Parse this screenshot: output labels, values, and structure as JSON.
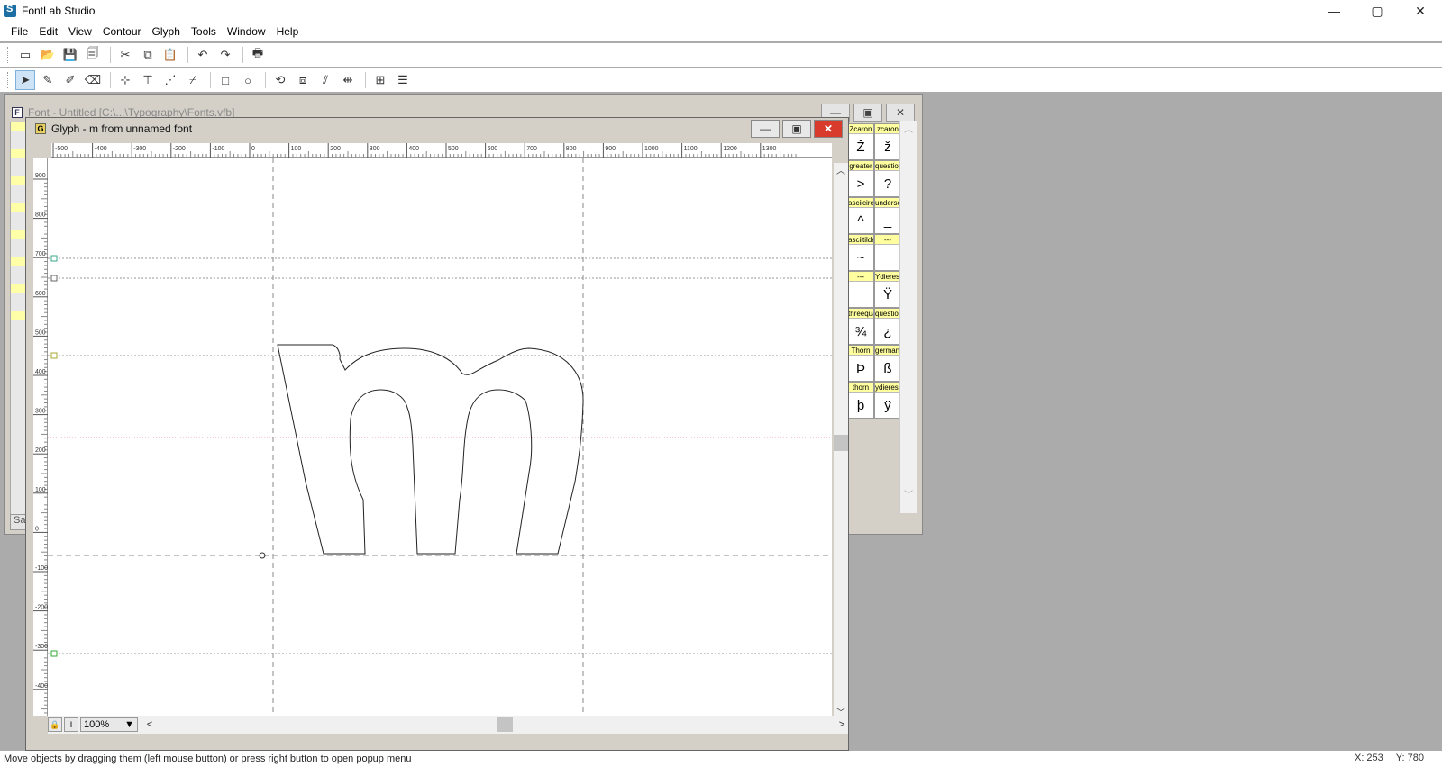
{
  "app": {
    "title": "FontLab Studio",
    "window_controls": {
      "minimize": "—",
      "maximize": "▢",
      "close": "✕"
    }
  },
  "menu": [
    "File",
    "Edit",
    "View",
    "Contour",
    "Glyph",
    "Tools",
    "Window",
    "Help"
  ],
  "toolbar1": [
    {
      "name": "new-icon",
      "glyph": "▭"
    },
    {
      "name": "open-icon",
      "glyph": "📂"
    },
    {
      "name": "save-icon",
      "glyph": "💾"
    },
    {
      "name": "save-all-icon",
      "glyph": "🗐"
    },
    {
      "name": "cut-icon",
      "glyph": "✂"
    },
    {
      "name": "copy-icon",
      "glyph": "⧉"
    },
    {
      "name": "paste-icon",
      "glyph": "📋"
    },
    {
      "name": "undo-icon",
      "glyph": "↶"
    },
    {
      "name": "redo-icon",
      "glyph": "↷"
    },
    {
      "name": "print-icon",
      "glyph": "🖶"
    }
  ],
  "toolbar2": [
    {
      "name": "pointer-tool-icon",
      "glyph": "➤",
      "active": true
    },
    {
      "name": "pen-tool-icon",
      "glyph": "✎"
    },
    {
      "name": "brush-tool-icon",
      "glyph": "✐"
    },
    {
      "name": "eraser-tool-icon",
      "glyph": "⌫"
    },
    {
      "name": "add-node-icon",
      "glyph": "⊹"
    },
    {
      "name": "add-corner-icon",
      "glyph": "⊤"
    },
    {
      "name": "add-curve-icon",
      "glyph": "⋰"
    },
    {
      "name": "add-tangent-icon",
      "glyph": "⌿"
    },
    {
      "name": "rectangle-tool-icon",
      "glyph": "□"
    },
    {
      "name": "ellipse-tool-icon",
      "glyph": "○"
    },
    {
      "name": "rotate-tool-icon",
      "glyph": "⟲"
    },
    {
      "name": "scale-tool-icon",
      "glyph": "⧈"
    },
    {
      "name": "slant-tool-icon",
      "glyph": "⫽"
    },
    {
      "name": "measure-tool-icon",
      "glyph": "⇹"
    },
    {
      "name": "grid-icon",
      "glyph": "⊞"
    },
    {
      "name": "align-icon",
      "glyph": "☰"
    }
  ],
  "font_window": {
    "title": "Font - Untitled [C:\\...\\Typography\\Fonts.vfb]",
    "status_left": "Sa",
    "glyph_cells": [
      [
        {
          "name": "Zcaron",
          "char": "Ž"
        },
        {
          "name": "zcaron",
          "char": "ž"
        }
      ],
      [
        {
          "name": "greater",
          "char": ">"
        },
        {
          "name": "question",
          "char": "?"
        }
      ],
      [
        {
          "name": "asciicircum",
          "char": "^"
        },
        {
          "name": "underscore",
          "char": "_"
        }
      ],
      [
        {
          "name": "asciitilde",
          "char": "~"
        },
        {
          "name": "---",
          "char": ""
        }
      ],
      [
        {
          "name": "---",
          "char": ""
        },
        {
          "name": "Ydieresis",
          "char": "Ÿ"
        }
      ],
      [
        {
          "name": "threequarters",
          "char": "¾"
        },
        {
          "name": "questiondown",
          "char": "¿"
        }
      ],
      [
        {
          "name": "Thorn",
          "char": "Þ"
        },
        {
          "name": "germandbls",
          "char": "ß"
        }
      ],
      [
        {
          "name": "thorn",
          "char": "þ"
        },
        {
          "name": "ydieresis",
          "char": "ÿ"
        }
      ]
    ]
  },
  "glyph_window": {
    "title": "Glyph - m from unnamed font",
    "zoom": "100%",
    "hruler_labels": [
      "-500",
      "-400",
      "-300",
      "-200",
      "-100",
      "0",
      "100",
      "200",
      "300",
      "400",
      "500",
      "600",
      "700",
      "800",
      "900",
      "1000",
      "1100",
      "1200",
      "1300"
    ],
    "vruler_labels": [
      "900",
      "800",
      "700",
      "600",
      "500",
      "400",
      "300",
      "200",
      "100",
      "0",
      "-100",
      "-200",
      "-300",
      "-400"
    ]
  },
  "status": {
    "message": "Move objects by dragging them (left mouse button) or press right button to open popup menu",
    "x": "X: 253",
    "y": "Y: 780"
  }
}
